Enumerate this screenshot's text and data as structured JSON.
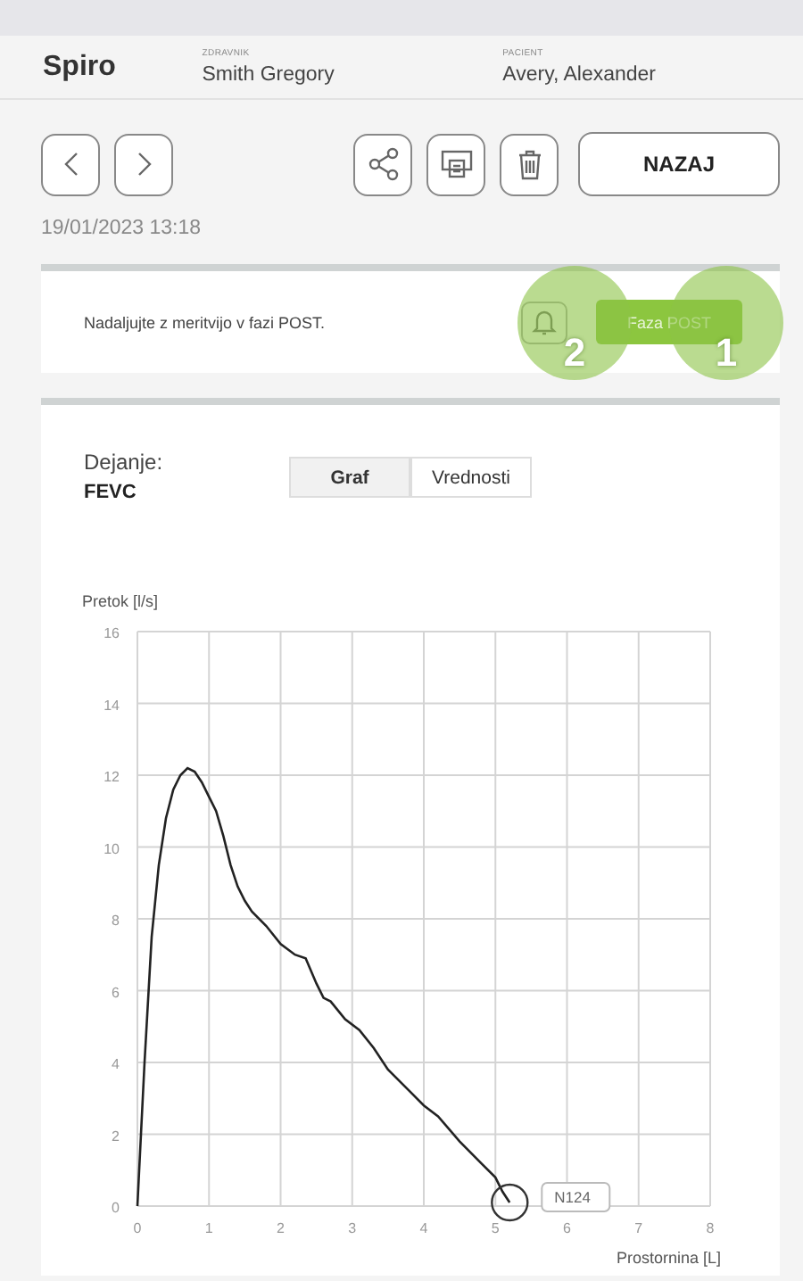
{
  "header": {
    "title": "Spiro",
    "fields": [
      {
        "label": "ZDRAVNIK",
        "value": "Smith Gregory"
      },
      {
        "label": "PACIENT",
        "value": "Avery, Alexander"
      }
    ]
  },
  "toolbar": {
    "nav": [
      {
        "kind": "back"
      },
      {
        "kind": "forward"
      }
    ],
    "actions": [
      {
        "kind": "share"
      },
      {
        "kind": "print"
      },
      {
        "kind": "delete"
      }
    ],
    "back_button": "NAZAJ"
  },
  "timestamp": "19/01/2023 13:18",
  "alert": {
    "message": "Nadaljujte z meritvijo v fazi POST.",
    "buttons": [
      {
        "kind": "bell",
        "callout": "2"
      },
      {
        "kind": "phase",
        "label": "Faza POST",
        "callout": "1"
      }
    ]
  },
  "measurement": {
    "label": "Dejanje:",
    "value": "FEVC",
    "views": [
      {
        "label": "Graf",
        "selected": true
      },
      {
        "label": "Vrednosti",
        "selected": false
      }
    ],
    "chart_data": {
      "type": "line",
      "grid": true,
      "ylabel": "Pretok [l/s]",
      "xlabel": "Prostornina [L]",
      "xlim": [
        0,
        8
      ],
      "ylim": [
        0,
        16
      ],
      "xticks": [
        0,
        1,
        2,
        3,
        4,
        5,
        6,
        7,
        8
      ],
      "yticks": [
        0,
        2,
        4,
        6,
        8,
        10,
        12,
        14,
        16
      ],
      "x": [
        0,
        0.1,
        0.2,
        0.3,
        0.4,
        0.5,
        0.6,
        0.7,
        0.8,
        0.9,
        1.0,
        1.1,
        1.2,
        1.3,
        1.4,
        1.5,
        1.6,
        1.8,
        2.0,
        2.2,
        2.35,
        2.5,
        2.6,
        2.7,
        2.9,
        3.1,
        3.3,
        3.5,
        3.8,
        4.0,
        4.2,
        4.5,
        4.8,
        5.0,
        5.1,
        5.2
      ],
      "series": [
        {
          "color": "#222222",
          "values": [
            0,
            4,
            7.5,
            9.5,
            10.8,
            11.6,
            12,
            12.2,
            12.1,
            11.8,
            11.4,
            11,
            10.3,
            9.5,
            8.9,
            8.5,
            8.2,
            7.8,
            7.3,
            7.0,
            6.9,
            6.2,
            5.8,
            5.7,
            5.2,
            4.9,
            4.4,
            3.8,
            3.2,
            2.8,
            2.5,
            1.8,
            1.2,
            0.8,
            0.4,
            0.1
          ]
        }
      ],
      "annotations": [
        "N124"
      ]
    }
  }
}
